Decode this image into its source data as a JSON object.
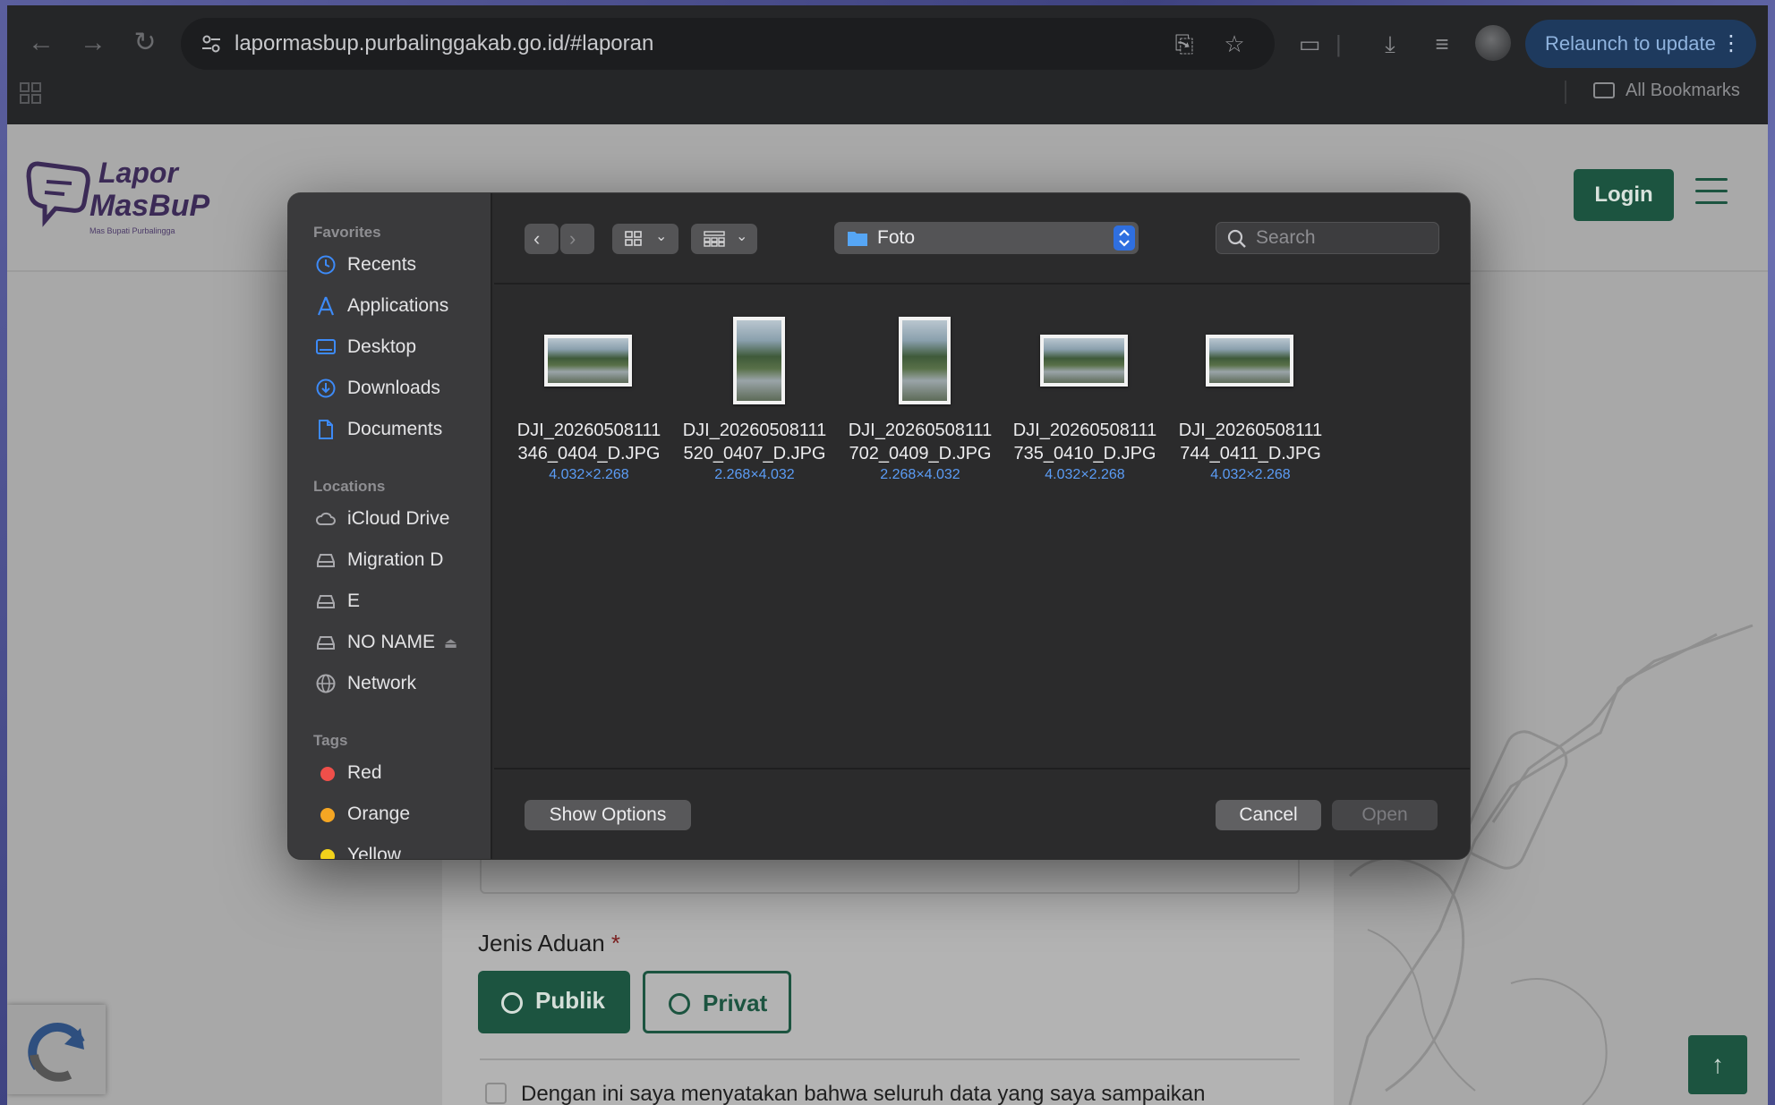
{
  "browser": {
    "url": "lapormasbup.purbalinggakab.go.id/#laporan",
    "relaunch_label": "Relaunch to update",
    "bookmarks_label": "All Bookmarks"
  },
  "page": {
    "logo_line1": "Lapor",
    "logo_line2": "MasBuP",
    "logo_tagline": "Mas Bupati Purbalingga",
    "login_label": "Login",
    "jenis_aduan_label": "Jenis Aduan",
    "required_mark": "*",
    "option_publik": "Publik",
    "option_privat": "Privat",
    "declaration_text": "Dengan ini saya menyatakan bahwa seluruh data yang saya sampaikan",
    "scroll_top_icon": "↑"
  },
  "dialog": {
    "current_folder": "Foto",
    "search_placeholder": "Search",
    "sidebar": {
      "favorites_title": "Favorites",
      "favorites": [
        {
          "label": "Recents",
          "icon": "clock-icon"
        },
        {
          "label": "Applications",
          "icon": "applications-icon"
        },
        {
          "label": "Desktop",
          "icon": "desktop-icon"
        },
        {
          "label": "Downloads",
          "icon": "downloads-icon"
        },
        {
          "label": "Documents",
          "icon": "document-icon"
        }
      ],
      "locations_title": "Locations",
      "locations": [
        {
          "label": "iCloud Drive",
          "icon": "cloud-icon"
        },
        {
          "label": "Migration D",
          "icon": "drive-icon"
        },
        {
          "label": "E",
          "icon": "drive-icon"
        },
        {
          "label": "NO NAME",
          "icon": "drive-icon"
        },
        {
          "label": "Network",
          "icon": "globe-icon"
        }
      ],
      "tags_title": "Tags",
      "tags": [
        {
          "label": "Red",
          "color": "#ef4f4a"
        },
        {
          "label": "Orange",
          "color": "#f5a623"
        },
        {
          "label": "Yellow",
          "color": "#f2d21b"
        }
      ]
    },
    "files": [
      {
        "line1": "DJI_20260508111",
        "line2": "346_0404_D.JPG",
        "dims": "4.032×2.268",
        "orientation": "landscape"
      },
      {
        "line1": "DJI_20260508111",
        "line2": "520_0407_D.JPG",
        "dims": "2.268×4.032",
        "orientation": "portrait"
      },
      {
        "line1": "DJI_20260508111",
        "line2": "702_0409_D.JPG",
        "dims": "2.268×4.032",
        "orientation": "portrait"
      },
      {
        "line1": "DJI_20260508111",
        "line2": "735_0410_D.JPG",
        "dims": "4.032×2.268",
        "orientation": "landscape"
      },
      {
        "line1": "DJI_20260508111",
        "line2": "744_0411_D.JPG",
        "dims": "4.032×2.268",
        "orientation": "landscape"
      }
    ],
    "show_options_label": "Show Options",
    "cancel_label": "Cancel",
    "open_label": "Open"
  }
}
